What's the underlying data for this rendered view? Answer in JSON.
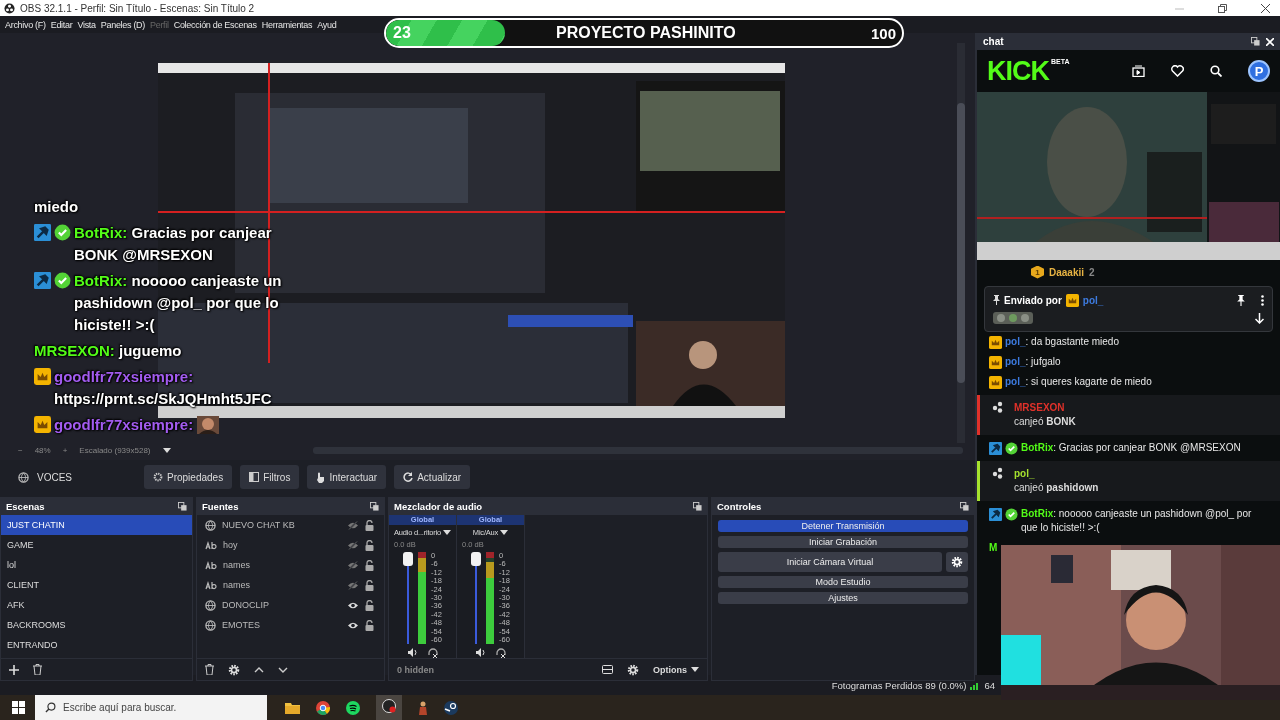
{
  "window": {
    "title": "OBS 32.1.1 - Perfil: Sin Título - Escenas: Sin Título 2"
  },
  "menu": [
    {
      "label": "Archivo (F)",
      "disabled": false
    },
    {
      "label": "Editar",
      "disabled": false
    },
    {
      "label": "Vista",
      "disabled": false
    },
    {
      "label": "Paneles (D)",
      "disabled": false
    },
    {
      "label": "Perfil",
      "disabled": true
    },
    {
      "label": "Colección de Escenas",
      "disabled": false
    },
    {
      "label": "Herramientas",
      "disabled": false
    },
    {
      "label": "Ayud",
      "disabled": false
    }
  ],
  "preview": {
    "kind": "picture",
    "zoom_out": "−",
    "zoom": "48%",
    "zoom_in": "+",
    "scale": "Escalado (939x528)"
  },
  "source_toolbar": {
    "source": "VOCES",
    "buttons": [
      "Propiedades",
      "Filtros",
      "Interactuar",
      "Actualizar"
    ]
  },
  "scenes": {
    "title": "Escenas",
    "items": [
      {
        "name": "JUST CHATIN",
        "selected": true
      },
      {
        "name": "GAME",
        "selected": false
      },
      {
        "name": "lol",
        "selected": false
      },
      {
        "name": "CLIENT",
        "selected": false
      },
      {
        "name": "AFK",
        "selected": false
      },
      {
        "name": "BACKROOMS",
        "selected": false
      },
      {
        "name": "ENTRANDO",
        "selected": false
      }
    ]
  },
  "sources": {
    "title": "Fuentes",
    "items": [
      {
        "name": "NUEVO CHAT KB",
        "kind": "browser",
        "visible": false
      },
      {
        "name": "hoy",
        "kind": "text",
        "visible": false
      },
      {
        "name": "names",
        "kind": "text",
        "visible": false
      },
      {
        "name": "names",
        "kind": "text",
        "visible": false
      },
      {
        "name": "DONOCLIP",
        "kind": "browser",
        "visible": true
      },
      {
        "name": "EMOTES",
        "kind": "browser",
        "visible": true
      }
    ]
  },
  "mixer": {
    "title": "Mezclador de audio",
    "channels": [
      {
        "group": "Global",
        "name": "Audio d...ritorio",
        "reading": "0.0 dB",
        "level": 1,
        "scale": [
          "0",
          "-6",
          "-12",
          "-18",
          "-24",
          "-30",
          "-36",
          "-42",
          "-48",
          "-54",
          "-60"
        ]
      },
      {
        "group": "Global",
        "name": "Mic/Aux",
        "reading": "0.0 dB",
        "level": 1,
        "scale": [
          "0",
          "-6",
          "-12",
          "-18",
          "-24",
          "-30",
          "-36",
          "-42",
          "-48",
          "-54",
          "-60"
        ]
      }
    ],
    "hidden": "0 hidden",
    "options": "Options"
  },
  "controls": {
    "title": "Controles",
    "buttons": [
      {
        "label": "Detener Transmisión",
        "kind": "plain",
        "active": true
      },
      {
        "label": "Iniciar Grabación",
        "kind": "plain",
        "active": false
      },
      {
        "label": "Iniciar Cámara Virtual",
        "kind": "with_settings",
        "active": false
      },
      {
        "label": "Modo Estudio",
        "kind": "plain",
        "active": false
      },
      {
        "label": "Ajustes",
        "kind": "plain",
        "active": false
      }
    ]
  },
  "chat_dock": {
    "title": "chat",
    "logo": "KICK",
    "logo_badge": "BETA",
    "avatar": "P",
    "top_gifter": {
      "rank": "1",
      "name": "Daaakii",
      "count": "2"
    },
    "pinned": {
      "label": "Enviado por",
      "user": "pol_",
      "badges": [
        {
          "kind": "crown"
        }
      ],
      "color": "#3d7be0"
    },
    "messages": [
      {
        "kind": "message",
        "badges": [
          {
            "kind": "crown"
          }
        ],
        "user": "pol_",
        "color": "#3d7be0",
        "text": ": da bgastante miedo"
      },
      {
        "kind": "message",
        "badges": [
          {
            "kind": "crown"
          }
        ],
        "user": "pol_",
        "color": "#3d7be0",
        "text": ": jufgalo"
      },
      {
        "kind": "message",
        "badges": [
          {
            "kind": "crown"
          }
        ],
        "user": "pol_",
        "color": "#3d7be0",
        "text": ": si queres kagarte de miedo"
      },
      {
        "kind": "redemption",
        "user": "MRSEXON",
        "color": "#e0312a",
        "text": "canjeó **BONK**"
      },
      {
        "kind": "message",
        "badges": [
          {
            "kind": "moderator"
          },
          {
            "kind": "verified"
          }
        ],
        "user": "BotRix",
        "color": "#53fc18",
        "text": ": Gracias por canjear BONK @MRSEXON"
      },
      {
        "kind": "redemption",
        "user": "pol_",
        "color": "#a6e22e",
        "text": "canjeó **pashidown**"
      },
      {
        "kind": "message",
        "badges": [
          {
            "kind": "moderator"
          },
          {
            "kind": "verified"
          }
        ],
        "user": "BotRix",
        "color": "#53fc18",
        "text": ": nooooo canjeaste un pashidown @pol_ por que lo hiciste!! >:("
      },
      {
        "kind": "message",
        "user": "M",
        "color": "#53fc18"
      }
    ]
  },
  "status_bar": {
    "dropped_frames": "Fotogramas Perdidos 89 (0.0%)",
    "bitrate": "64"
  },
  "taskbar": {
    "search_placeholder": "Escribe aquí para buscar."
  },
  "overlay": {
    "goal": {
      "current": "23",
      "title": "PROYECTO PASHINITO",
      "target": "100",
      "level": 0.23
    },
    "chat": [
      {
        "kind": "message",
        "text": "miedo"
      },
      {
        "kind": "message",
        "badges": [
          {
            "kind": "moderator"
          },
          {
            "kind": "verified"
          }
        ],
        "user": "BotRix:",
        "color": "#53fc18",
        "text": "Gracias por canjear BONK @MRSEXON"
      },
      {
        "kind": "message",
        "badges": [
          {
            "kind": "moderator"
          },
          {
            "kind": "verified"
          }
        ],
        "user": "BotRix:",
        "color": "#53fc18",
        "text": "nooooo canjeaste un pashidown @pol_ por que lo hiciste!! >:("
      },
      {
        "kind": "message",
        "user": "MRSEXON:",
        "color": "#53fc18",
        "text": "juguemo"
      },
      {
        "kind": "message",
        "badges": [
          {
            "kind": "crown"
          }
        ],
        "user": "goodlfr77xsiempre:",
        "color": "#a35cf0",
        "text": "https://prnt.sc/SkJQHmht5JFC"
      },
      {
        "kind": "emote",
        "badges": [
          {
            "kind": "crown"
          }
        ],
        "user": "goodlfr77xsiempre:",
        "color": "#a35cf0"
      }
    ]
  }
}
